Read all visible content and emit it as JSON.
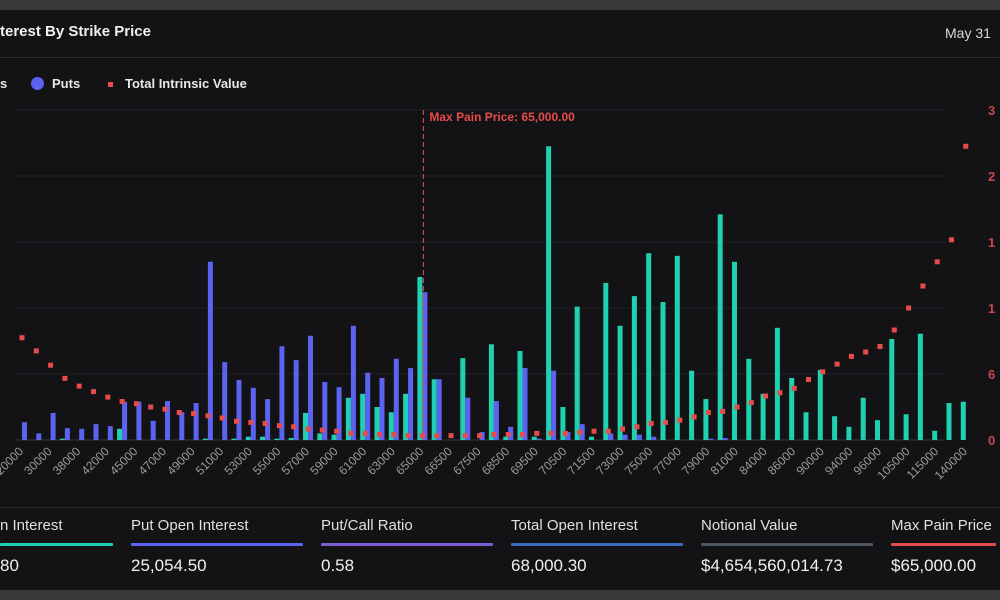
{
  "header": {
    "title": "terest By Strike Price",
    "date": "May 31"
  },
  "legend": {
    "calls_partial": "s",
    "puts": "Puts",
    "intrinsic": "Total Intrinsic Value"
  },
  "colors": {
    "calls": "#1fd1b0",
    "puts": "#5b63f0",
    "intrinsic": "#e84b4b",
    "max_pain": "#e84b4b"
  },
  "chart_data": {
    "type": "bar",
    "categories": [
      "20000",
      "",
      "30000",
      "",
      "38000",
      "",
      "42000",
      "",
      "45000",
      "",
      "47000",
      "",
      "49000",
      "",
      "51000",
      "",
      "53000",
      "",
      "55000",
      "",
      "57000",
      "",
      "59000",
      "",
      "61000",
      "",
      "63000",
      "",
      "65000",
      "",
      "66500",
      "",
      "67500",
      "",
      "68500",
      "",
      "69500",
      "",
      "70500",
      "",
      "71500",
      "",
      "73000",
      "",
      "75000",
      "",
      "77000",
      "",
      "79000",
      "",
      "81000",
      "",
      "84000",
      "",
      "86000",
      "",
      "90000",
      "",
      "94000",
      "",
      "96000",
      "",
      "105000",
      "",
      "115000",
      "",
      "140000"
    ],
    "series": [
      {
        "name": "Puts",
        "kind": "bar",
        "axis": "left",
        "values": [
          0.27,
          0.1,
          0.41,
          0.18,
          0.17,
          0.24,
          0.21,
          0.58,
          0.58,
          0.29,
          0.59,
          0.42,
          0.56,
          2.7,
          1.18,
          0.91,
          0.79,
          0.62,
          1.42,
          1.21,
          1.58,
          0.88,
          0.8,
          1.73,
          1.02,
          0.94,
          1.23,
          1.09,
          2.24,
          0.92,
          0,
          0.64,
          0.12,
          0.59,
          0.2,
          1.09,
          0.02,
          1.05,
          0.12,
          0.24,
          0,
          0.1,
          0.08,
          0.08,
          0.05,
          0,
          0,
          0,
          0.02,
          0.03,
          0,
          0,
          0,
          0,
          0,
          0,
          0,
          0,
          0,
          0,
          0,
          0,
          0,
          0,
          0,
          0,
          0
        ]
      },
      {
        "name": "Calls",
        "kind": "bar",
        "axis": "left",
        "values": [
          0,
          0,
          0,
          0.02,
          0,
          0,
          0,
          0.17,
          0,
          0,
          0,
          0,
          0,
          0.02,
          0,
          0.02,
          0.05,
          0.05,
          0.02,
          0.03,
          0.41,
          0.1,
          0.08,
          0.64,
          0.7,
          0.5,
          0.42,
          0.7,
          2.47,
          0.92,
          0,
          1.24,
          0,
          1.45,
          0.05,
          1.35,
          0.05,
          4.45,
          0.5,
          2.02,
          0.05,
          2.38,
          1.73,
          2.18,
          2.83,
          2.09,
          2.79,
          1.05,
          0.62,
          3.42,
          2.7,
          1.23,
          0.7,
          1.7,
          0.94,
          0.42,
          1.06,
          0.36,
          0.2,
          0.64,
          0.3,
          1.53,
          0.39,
          1.61,
          0.14,
          0.56,
          0.58
        ]
      },
      {
        "name": "Total Intrinsic Value",
        "kind": "scatter",
        "axis": "right",
        "values": [
          93,
          81,
          68,
          56,
          49,
          44,
          39,
          35,
          33,
          30,
          28,
          25,
          24,
          22,
          20,
          17,
          16,
          15,
          13,
          12,
          10,
          9,
          8,
          6,
          6,
          5,
          5,
          4,
          4,
          4,
          4,
          4,
          4,
          5,
          5,
          5,
          6,
          6,
          6,
          7,
          8,
          8,
          10,
          12,
          15,
          16,
          18,
          21,
          25,
          26,
          30,
          34,
          40,
          43,
          47,
          55,
          62,
          69,
          76,
          80,
          85,
          100,
          120,
          140,
          162,
          182,
          267
        ]
      }
    ],
    "y_left_range": [
      0,
      5
    ],
    "y_right_range": [
      0,
      300
    ],
    "y_right_tick_labels": [
      "0",
      "6",
      "1",
      "1",
      "2",
      "3"
    ],
    "max_pain": {
      "category": "65000",
      "label": "Max Pain Price: 65,000.00"
    },
    "grid": true,
    "legend_position": "top-left"
  },
  "stats": [
    {
      "label": "n Interest",
      "value": "80",
      "color": "#1fd1b0"
    },
    {
      "label": "Put Open Interest",
      "value": "25,054.50",
      "color": "#5b63f0"
    },
    {
      "label": "Put/Call Ratio",
      "value": "0.58",
      "color": "#7a5cd4"
    },
    {
      "label": "Total Open Interest",
      "value": "68,000.30",
      "color": "#3b6cc4"
    },
    {
      "label": "Notional Value",
      "value": "$4,654,560,014.73",
      "color": "#4a5661"
    },
    {
      "label": "Max Pain Price",
      "value": "$65,000.00",
      "color": "#e24c4c"
    }
  ]
}
